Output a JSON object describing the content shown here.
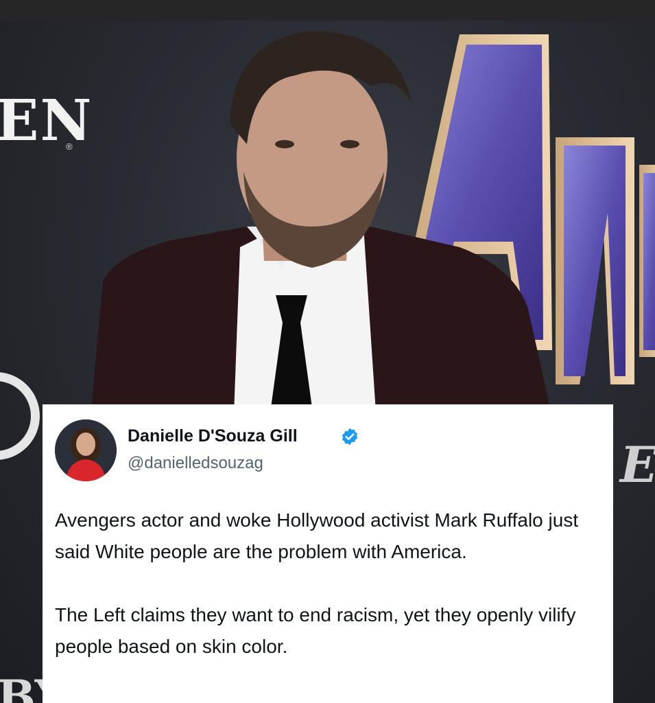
{
  "background": {
    "backdrop_letters": "EN",
    "backdrop_registered": "®",
    "backdrop_bottom_letters": "BY",
    "backdrop_right_letter": "E"
  },
  "tweet": {
    "name": "Danielle D'Souza Gill",
    "handle": "@danielledsouzag",
    "paragraphs": [
      "Avengers actor and woke Hollywood activist Mark Ruffalo just said White people are the problem with America.",
      "The Left claims they want to end racism, yet they openly vilify people based on skin color."
    ]
  },
  "colors": {
    "card_background": "#ffffff",
    "name_text": "#0f1419",
    "handle_text": "#536471",
    "verified_badge": "#1d9bf0",
    "backdrop": "#2a2c33"
  },
  "icons": {
    "verified": "verified-badge-icon",
    "avatar": "profile-avatar"
  }
}
